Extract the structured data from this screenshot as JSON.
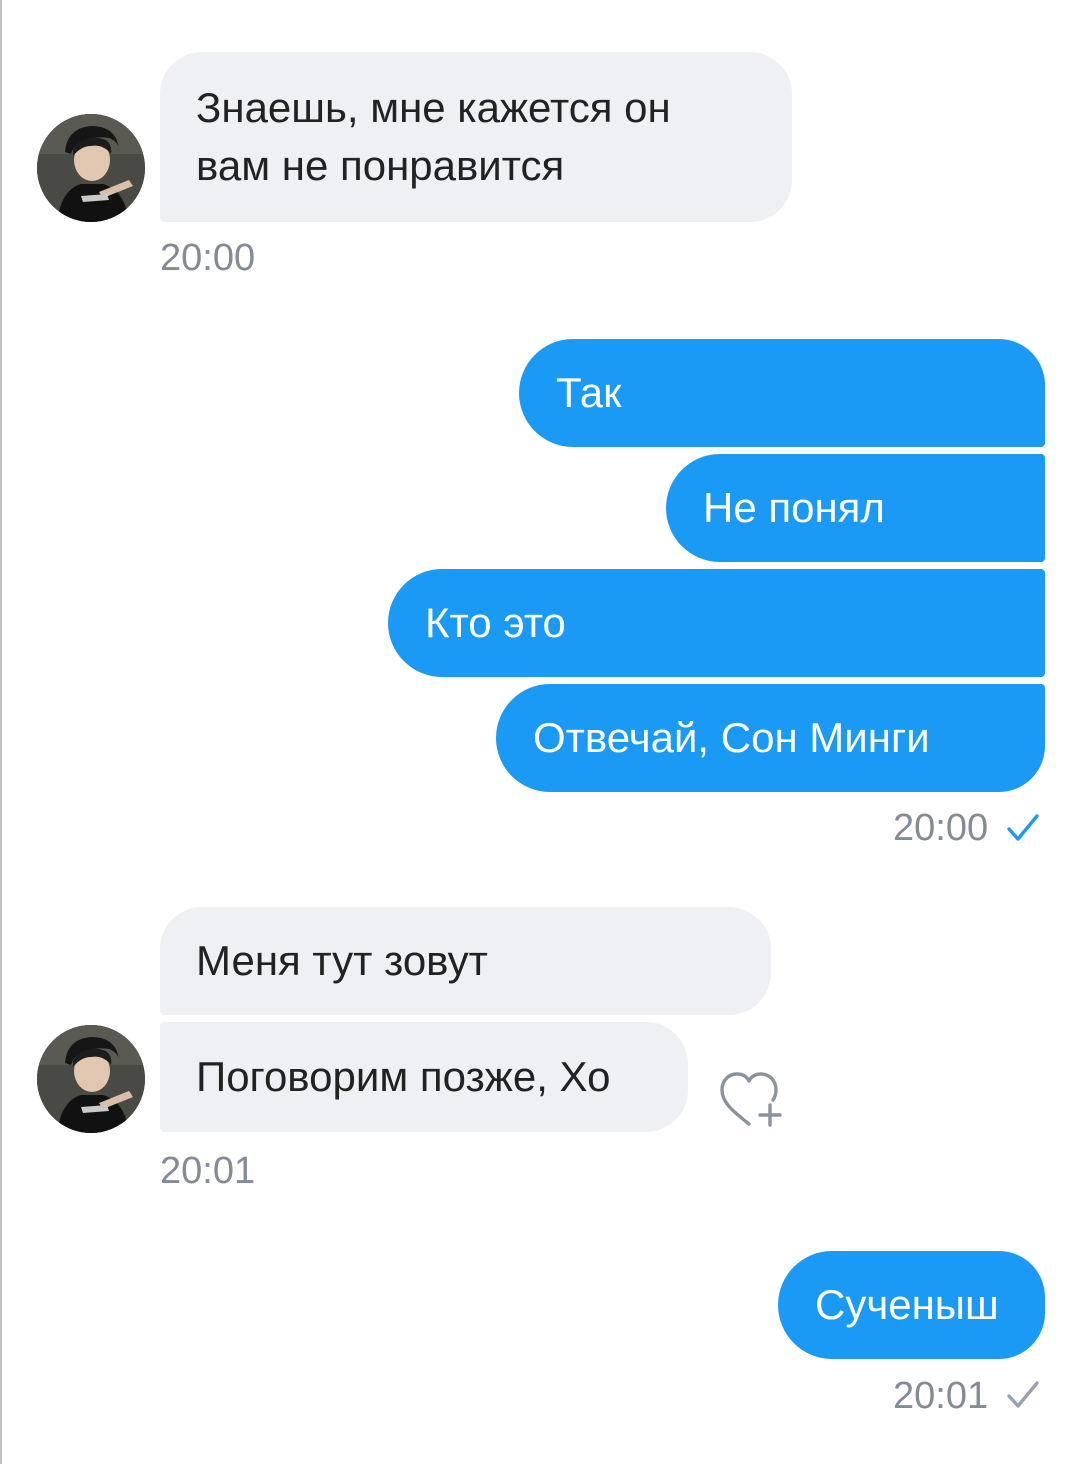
{
  "colors": {
    "incoming_bubble": "#eef0f4",
    "outgoing_bubble": "#1a99f5",
    "timestamp": "#828b96",
    "read_check": "#1a99f5",
    "sent_check": "#9aa1aa"
  },
  "messages": {
    "group1": {
      "lines": [
        "Знаешь, мне кажется он",
        "вам не понравится"
      ],
      "time": "20:00"
    },
    "group2": {
      "items": [
        "Так",
        "Не понял",
        "Кто это",
        "Отвечай, Сон Минги"
      ],
      "time": "20:00",
      "status_icon": "check-read-icon"
    },
    "group3": {
      "items": [
        "Меня тут зовут",
        "Поговорим позже, Хо"
      ],
      "time": "20:01",
      "reaction_icon": "heart-add-icon"
    },
    "group4": {
      "items": [
        "Сученыш"
      ],
      "time": "20:01",
      "status_icon": "check-sent-icon"
    }
  }
}
